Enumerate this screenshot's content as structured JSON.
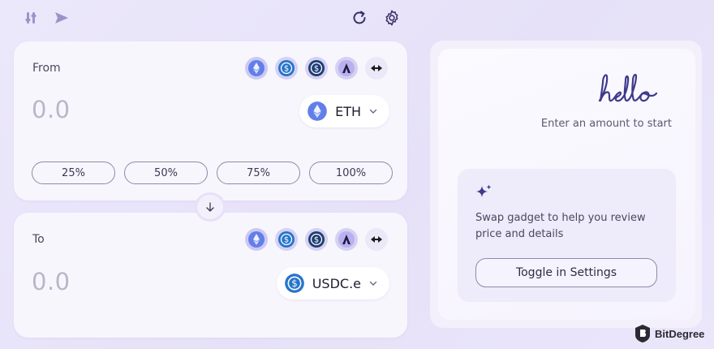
{
  "toolbar": {
    "icons": [
      "sliders-icon",
      "send-icon",
      "refresh-icon",
      "gear-icon"
    ]
  },
  "from": {
    "label": "From",
    "amount": "0.0",
    "token": "ETH",
    "percent_buttons": [
      "25%",
      "50%",
      "75%",
      "100%"
    ]
  },
  "to": {
    "label": "To",
    "amount": "0.0",
    "token": "USDC.e"
  },
  "quick_tokens": [
    "eth-icon",
    "usdc-icon",
    "usdc-dark-icon",
    "arb-icon",
    "bridge-icon"
  ],
  "panel": {
    "greeting": "hello",
    "hint": "Enter an amount to start",
    "gadget_text": "Swap gadget to help you review price and details",
    "toggle_label": "Toggle in Settings"
  },
  "watermark": "BitDegree",
  "colors": {
    "accent": "#6c5ce7",
    "eth": "#627eea",
    "usdc": "#2775ca",
    "text_muted": "#b9b6c9"
  }
}
